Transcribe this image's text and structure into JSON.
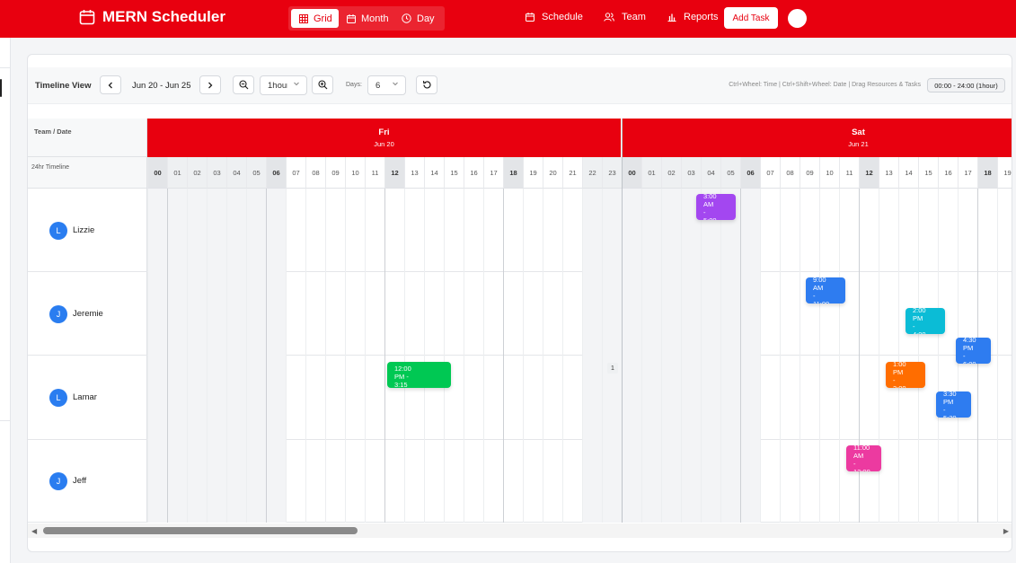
{
  "app": {
    "title": "MERN Scheduler"
  },
  "view_switch": [
    {
      "label": "Grid",
      "icon": "grid-icon",
      "active": true
    },
    {
      "label": "Month",
      "icon": "calendar-icon",
      "active": false
    },
    {
      "label": "Day",
      "icon": "clock-icon",
      "active": false
    }
  ],
  "nav": [
    {
      "label": "Schedule",
      "icon": "calendar-icon"
    },
    {
      "label": "Team",
      "icon": "users-icon"
    },
    {
      "label": "Reports",
      "icon": "bar-chart-icon"
    }
  ],
  "add_task_label": "Add Task",
  "toolbar": {
    "title": "Timeline View",
    "date_range": "Jun 20 - Jun 25",
    "zoom_value": "1hour",
    "days_label": "Days:",
    "days_value": "6",
    "hint": "Ctrl+Wheel: Time | Ctrl+Shift+Wheel: Date | Drag Resources & Tasks",
    "range_badge": "00:00 - 24:00 (1hour)"
  },
  "grid": {
    "corner_top": "Team / Date",
    "corner_bottom": "24hr Timeline",
    "days": [
      {
        "name": "Fri",
        "date": "Jun 20"
      },
      {
        "name": "Sat",
        "date": "Jun 21"
      }
    ],
    "hour_labels": [
      "00",
      "01",
      "02",
      "03",
      "04",
      "05",
      "06",
      "07",
      "08",
      "09",
      "10",
      "11",
      "12",
      "13",
      "14",
      "15",
      "16",
      "17",
      "18",
      "19",
      "20",
      "21",
      "22",
      "23"
    ],
    "resources": [
      {
        "initial": "L",
        "name": "Lizzie"
      },
      {
        "initial": "J",
        "name": "Jeremie"
      },
      {
        "initial": "L",
        "name": "Lamar"
      },
      {
        "initial": "J",
        "name": "Jeff"
      }
    ],
    "tasks": [
      {
        "resource": 0,
        "lines": [
          "3:00",
          "AM",
          "-",
          "5:00"
        ],
        "color": "#a347f0"
      },
      {
        "resource": 1,
        "lines": [
          "9:00",
          "AM",
          "-",
          "11:00"
        ],
        "color": "#2e7cf0"
      },
      {
        "resource": 1,
        "lines": [
          "2:00",
          "PM",
          "-",
          "4:00"
        ],
        "color": "#0bbcd6"
      },
      {
        "resource": 1,
        "lines": [
          "4:30",
          "PM",
          "-",
          "6:00"
        ],
        "color": "#2e7cf0"
      },
      {
        "resource": 2,
        "lines": [
          "12:00",
          "PM -",
          "3:15"
        ],
        "color": "#00c853"
      },
      {
        "resource": 2,
        "lines": [
          "1:00",
          "PM",
          "-",
          "3:00"
        ],
        "color": "#ff6d00"
      },
      {
        "resource": 2,
        "lines": [
          "3:30",
          "PM",
          "-",
          "5:30"
        ],
        "color": "#2e7cf0"
      },
      {
        "resource": 3,
        "lines": [
          "11:00",
          "AM",
          "-",
          "12:00"
        ],
        "color": "#ec3aa0"
      }
    ],
    "badge": "1"
  }
}
